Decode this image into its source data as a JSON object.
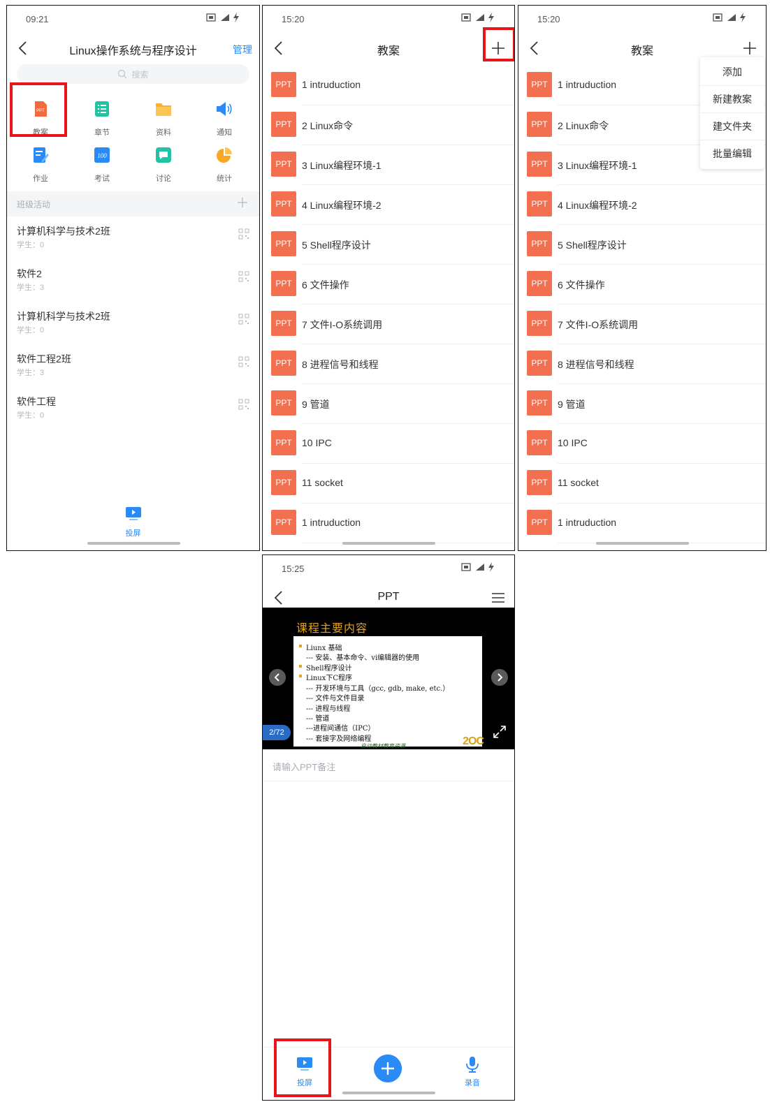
{
  "screen1": {
    "time": "09:21",
    "title": "Linux操作系统与程序设计",
    "manage": "管理",
    "search_placeholder": "搜索",
    "grid": [
      {
        "label": "教案",
        "icon": "ppt-icon"
      },
      {
        "label": "章节",
        "icon": "chapter-icon"
      },
      {
        "label": "资料",
        "icon": "folder-icon"
      },
      {
        "label": "通知",
        "icon": "speaker-icon"
      },
      {
        "label": "作业",
        "icon": "homework-icon"
      },
      {
        "label": "考试",
        "icon": "exam-icon"
      },
      {
        "label": "讨论",
        "icon": "chat-icon"
      },
      {
        "label": "统计",
        "icon": "pie-chart-icon"
      }
    ],
    "section_title": "班级活动",
    "classes": [
      {
        "name": "计算机科学与技术2班",
        "students": "学生：0"
      },
      {
        "name": "软件2",
        "students": "学生：3"
      },
      {
        "name": "计算机科学与技术2班",
        "students": "学生：0"
      },
      {
        "name": "软件工程2班",
        "students": "学生：3"
      },
      {
        "name": "软件工程",
        "students": "学生：0"
      }
    ],
    "cast_label": "投屏"
  },
  "screen2": {
    "time": "15:20",
    "title": "教案",
    "items": [
      {
        "badge": "PPT",
        "name": "1 intruduction"
      },
      {
        "badge": "PPT",
        "name": "2 Linux命令"
      },
      {
        "badge": "PPT",
        "name": "3 Linux编程环境-1"
      },
      {
        "badge": "PPT",
        "name": "4 Linux编程环境-2"
      },
      {
        "badge": "PPT",
        "name": "5 Shell程序设计"
      },
      {
        "badge": "PPT",
        "name": "6 文件操作"
      },
      {
        "badge": "PPT",
        "name": "7 文件I-O系统调用"
      },
      {
        "badge": "PPT",
        "name": "8 进程信号和线程"
      },
      {
        "badge": "PPT",
        "name": "9 管道"
      },
      {
        "badge": "PPT",
        "name": "10 IPC"
      },
      {
        "badge": "PPT",
        "name": "11 socket"
      },
      {
        "badge": "PPT",
        "name": "1 intruduction"
      }
    ]
  },
  "screen3": {
    "time": "15:20",
    "title": "教案",
    "menu": [
      "添加",
      "新建教案",
      "建文件夹",
      "批量编辑"
    ],
    "items": [
      {
        "badge": "PPT",
        "name": "1 intruduction"
      },
      {
        "badge": "PPT",
        "name": "2 Linux命令"
      },
      {
        "badge": "PPT",
        "name": "3 Linux编程环境-1"
      },
      {
        "badge": "PPT",
        "name": "4 Linux编程环境-2"
      },
      {
        "badge": "PPT",
        "name": "5 Shell程序设计"
      },
      {
        "badge": "PPT",
        "name": "6 文件操作"
      },
      {
        "badge": "PPT",
        "name": "7 文件I-O系统调用"
      },
      {
        "badge": "PPT",
        "name": "8 进程信号和线程"
      },
      {
        "badge": "PPT",
        "name": "9 管道"
      },
      {
        "badge": "PPT",
        "name": "10 IPC"
      },
      {
        "badge": "PPT",
        "name": "11 socket"
      },
      {
        "badge": "PPT",
        "name": "1 intruduction"
      }
    ]
  },
  "screen4": {
    "time": "15:25",
    "title": "PPT",
    "slide": {
      "title": "课程主要内容",
      "lines": [
        {
          "text": "Liunx 基础",
          "bullet": true
        },
        {
          "text": "--- 安装、基本命令、vi编辑器的使用",
          "bullet": false
        },
        {
          "text": "Shell程序设计",
          "bullet": true
        },
        {
          "text": "Linux下C程序",
          "bullet": true
        },
        {
          "text": "--- 开发环境与工具（gcc, gdb, make, etc.）",
          "bullet": false
        },
        {
          "text": "--- 文件与文件目录",
          "bullet": false
        },
        {
          "text": "--- 进程与线程",
          "bullet": false
        },
        {
          "text": "--- 管道",
          "bullet": false
        },
        {
          "text": "---进程间通信（IPC）",
          "bullet": false
        },
        {
          "text": "--- 套接字及网络编程",
          "bullet": false
        }
      ],
      "footer": "启动教材教育资源",
      "logo": "2OC",
      "page": "2/72"
    },
    "note_placeholder": "请输入PPT备注",
    "cast_label": "投屏",
    "record_label": "录音"
  },
  "colors": {
    "accent": "#2a8af6",
    "ppt_badge": "#f2704f",
    "highlight": "#e8141b"
  }
}
